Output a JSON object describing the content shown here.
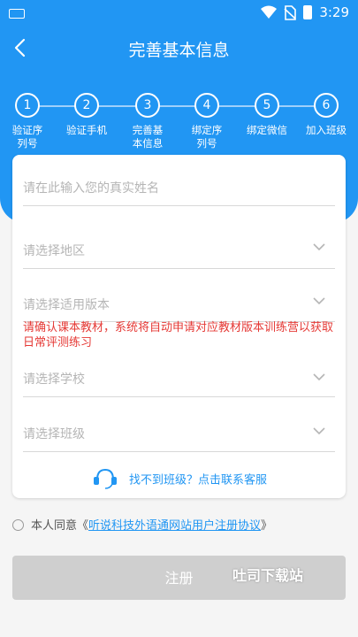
{
  "status_bar": {
    "time": "3:29"
  },
  "header": {
    "title": "完善基本信息"
  },
  "steps": [
    {
      "num": "1",
      "label": "验证序\n列号"
    },
    {
      "num": "2",
      "label": "验证手机"
    },
    {
      "num": "3",
      "label": "完善基\n本信息"
    },
    {
      "num": "4",
      "label": "绑定序\n列号"
    },
    {
      "num": "5",
      "label": "绑定微信"
    },
    {
      "num": "6",
      "label": "加入班级"
    }
  ],
  "form": {
    "name_placeholder": "请在此输入您的真实姓名",
    "region_placeholder": "请选择地区",
    "edition_placeholder": "请选择适用版本",
    "notice": "请确认课本教材，系统将自动申请对应教材版本训练营以获取日常评测练习",
    "school_placeholder": "请选择学校",
    "class_placeholder": "请选择班级",
    "service_text": "找不到班级？点击联系客服"
  },
  "agreement": {
    "prefix": "本人同意《",
    "link": "听说科技外语通网站用户注册协议",
    "suffix": "》"
  },
  "register_label": "注册",
  "watermark": "吐司下载站",
  "colors": {
    "primary": "#2196f3",
    "error": "#e53935",
    "disabled": "#cfcfcf"
  }
}
